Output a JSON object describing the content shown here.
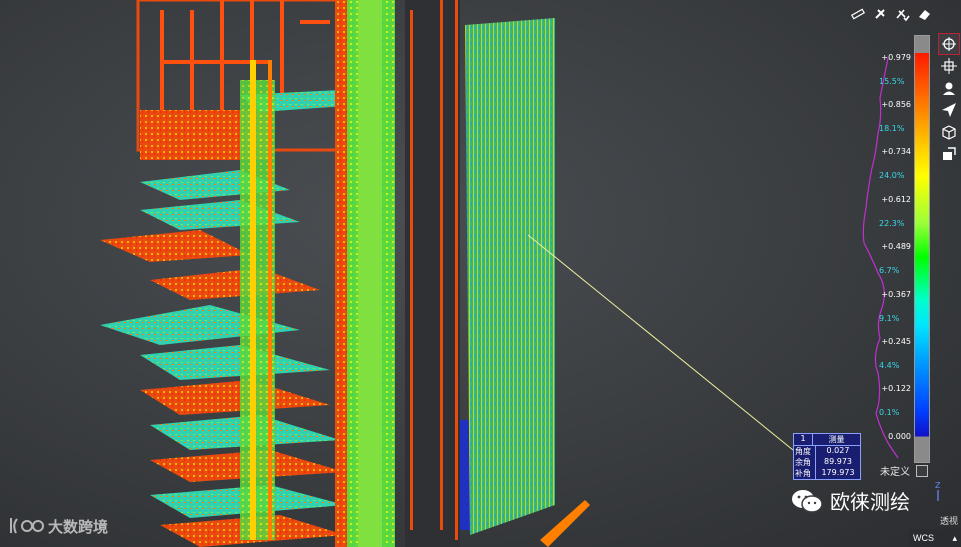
{
  "toolbar_top": {
    "icons": [
      "measure-ruler-icon",
      "clip-icon",
      "clip-check-icon",
      "eraser-icon"
    ]
  },
  "toolbar_side": {
    "icons": [
      "orbit-icon",
      "pan-icon",
      "viewpoint-icon",
      "send-icon",
      "box-icon",
      "layers-icon"
    ]
  },
  "color_scale": {
    "values": [
      "+0.979",
      "+0.856",
      "+0.734",
      "+0.612",
      "+0.489",
      "+0.367",
      "+0.245",
      "+0.122",
      "0.000"
    ],
    "percentages": [
      "15.5%",
      "18.1%",
      "24.0%",
      "22.3%",
      "6.7%",
      "9.1%",
      "4.4%",
      "0.1%"
    ],
    "undefined_label": "未定义"
  },
  "measurement": {
    "id": "1",
    "title": "测量",
    "rows": [
      {
        "key": "角度",
        "value": "0.027"
      },
      {
        "key": "余角",
        "value": "89.973"
      },
      {
        "key": "补角",
        "value": "179.973"
      }
    ]
  },
  "watermark_left": "大数跨境",
  "watermark_right": "欧徕测绘",
  "view_mode": "透视",
  "coord_system": "WCS",
  "colors": {
    "accent_red": "#ff3300",
    "accent_green": "#33ff33",
    "measure_bg": "#1a1e70",
    "pct_text": "#38d8e8"
  }
}
